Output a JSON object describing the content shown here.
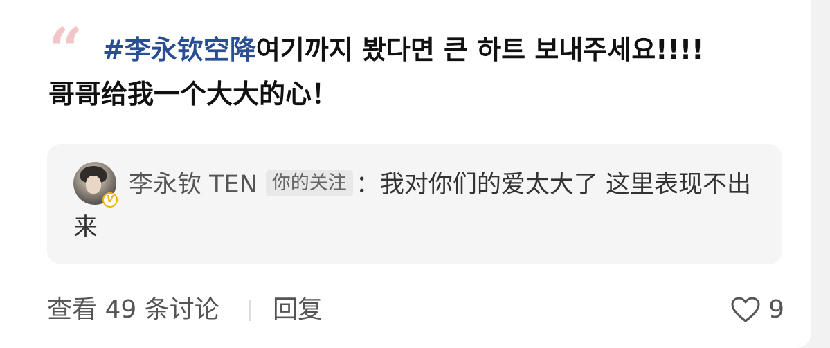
{
  "post": {
    "hashtag": "#李永钦空降",
    "text_line1": "여기까지 봤다면 큰 하트 보내주세요!!!!",
    "text_line2": "哥哥给我一个大大的心！",
    "quote_icon": "quote-mark-icon"
  },
  "repost": {
    "username": "李永钦 TEN",
    "badge": "你的关注",
    "separator": "：",
    "text": "我对你们的爱太大了 这里表现不出来",
    "avatar_icon": "avatar-image",
    "verified_icon": "verified-v-icon",
    "verified_label": "V"
  },
  "footer": {
    "discussion_label": "查看 49 条讨论",
    "reply_label": "回复",
    "like_icon": "heart-outline-icon",
    "like_count": "9"
  },
  "colors": {
    "hashtag": "#2a4e94",
    "quote_mark": "#f2c6c8",
    "verified": "#f0b400",
    "repost_bg": "#f5f5f5"
  }
}
